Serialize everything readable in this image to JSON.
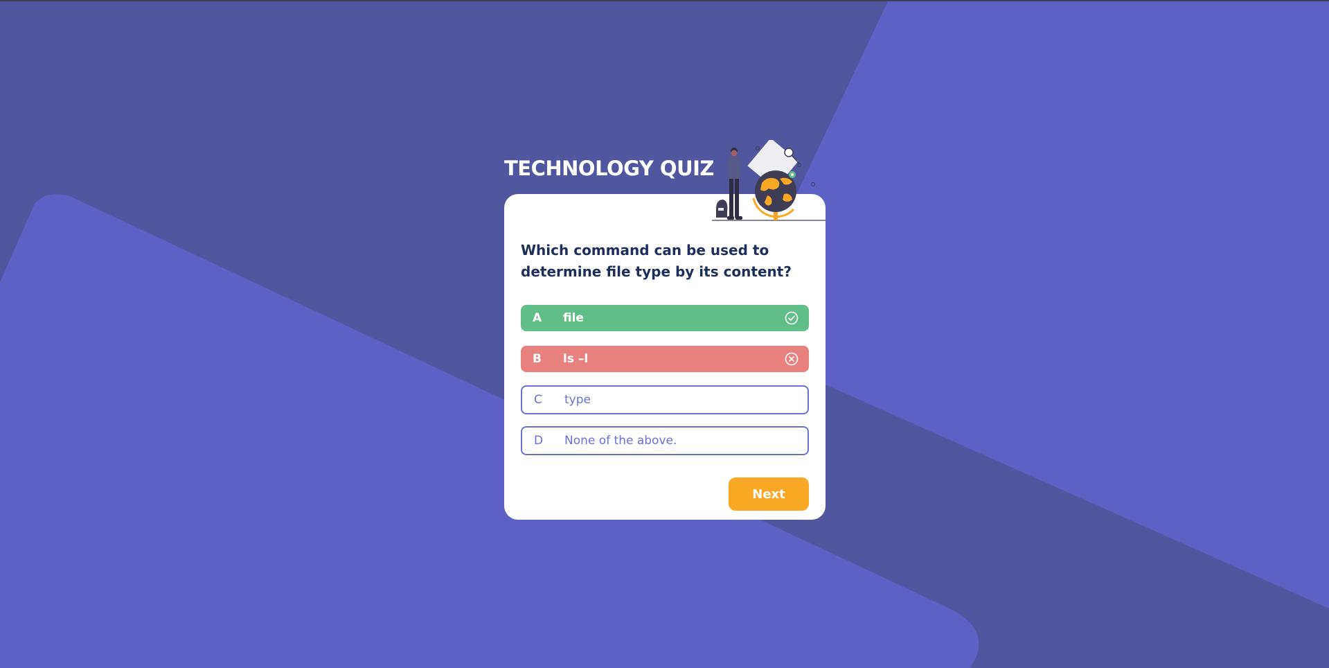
{
  "quiz": {
    "title": "TECHNOLOGY QUIZ",
    "question": "Which command can be used to determine file type by its content?",
    "options": [
      {
        "letter": "A",
        "text": "file",
        "state": "correct",
        "icon": "check-circle-icon"
      },
      {
        "letter": "B",
        "text": "ls –l",
        "state": "incorrect",
        "icon": "x-circle-icon"
      },
      {
        "letter": "C",
        "text": "type",
        "state": "unselected"
      },
      {
        "letter": "D",
        "text": "None of the above.",
        "state": "unselected"
      }
    ],
    "next_label": "Next"
  },
  "colors": {
    "background_dark": "#51569e",
    "background_light": "#5c62c5",
    "title_text": "#ffffff",
    "question_text": "#1f2d5a",
    "correct": "#62be87",
    "incorrect": "#e8807e",
    "option_outline": "#6b6fd6",
    "accent": "#f9a826"
  },
  "illustration": {
    "icon": "person-with-globe-illustration"
  }
}
